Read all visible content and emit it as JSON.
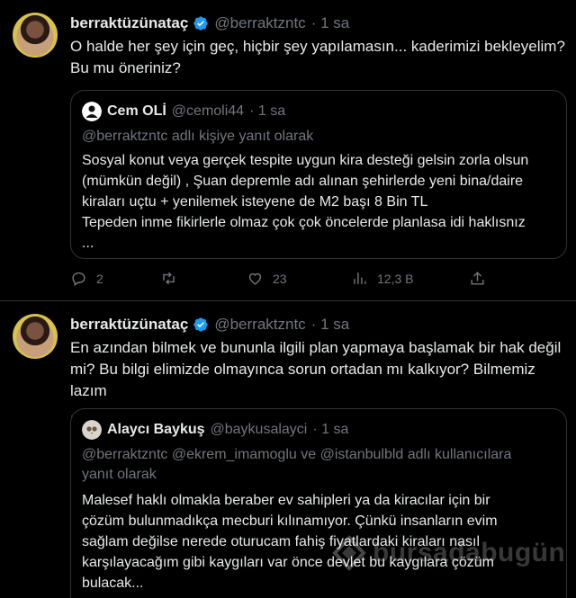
{
  "tweets": [
    {
      "author_name": "berraktüzünataç",
      "handle": "@berraktzntc",
      "time": "· 1 sa",
      "text_lines": [
        "O halde her şey için geç, hiçbir şey yapılamasın... kaderimizi bekleyelim?",
        "Bu mu öneriniz?"
      ],
      "quote": {
        "author_name": "Cem OLİ",
        "handle": "@cemoli44",
        "time": "· 1 sa",
        "reply_line": "@berraktzntc adlı kişiye yanıt olarak",
        "text_lines": [
          "Sosyal konut veya gerçek tespite uygun kira desteği gelsin zorla olsun",
          "(mümkün değil) , Şuan depremle adı alınan şehirlerde yeni bina/daire",
          "kiraları uçtu + yenilemek isteyene de M2 başı 8 Bin TL",
          "Tepeden inme fikirlerle olmaz çok çok öncelerde planlasa idi haklısnız",
          "..."
        ]
      },
      "actions": {
        "replies": "2",
        "retweets": "",
        "likes": "23",
        "views": "12,3 B"
      }
    },
    {
      "author_name": "berraktüzünataç",
      "handle": "@berraktzntc",
      "time": "· 1 sa",
      "text_lines": [
        "En azından bilmek ve bununla ilgili plan yapmaya başlamak bir hak değil",
        "mi? Bu bilgi elimizde olmayınca sorun ortadan mı kalkıyor? Bilmemiz lazım",
        "."
      ],
      "quote": {
        "author_name": "Alaycı Baykuş",
        "handle": "@baykusalayci",
        "time": "· 1 sa",
        "reply_lines": [
          "@berraktzntc @ekrem_imamoglu ve @istanbulbld adlı kullanıcılara",
          "yanıt olarak"
        ],
        "text_lines": [
          "Malesef haklı olmakla beraber ev sahipleri ya da kiracılar için bir",
          "çözüm bulunmadıkça mecburi kılınamıyor. Çünkü insanların evim",
          "sağlam değilse nerede oturucam fahiş fiyatlardaki kiraları nasıl",
          "karşılayacağım gibi kaygıları var önce devlet bu kaygılara çözüm",
          "bulacak..."
        ]
      }
    }
  ],
  "watermark": "bursadabugün",
  "colors": {
    "background": "#000000",
    "text": "#e7e9ea",
    "muted": "#71767b",
    "verified": "#1d9bf0",
    "border": "#2f3336"
  },
  "icons": [
    "verified-badge-icon",
    "reply-icon",
    "retweet-icon",
    "like-icon",
    "views-icon",
    "share-icon"
  ]
}
